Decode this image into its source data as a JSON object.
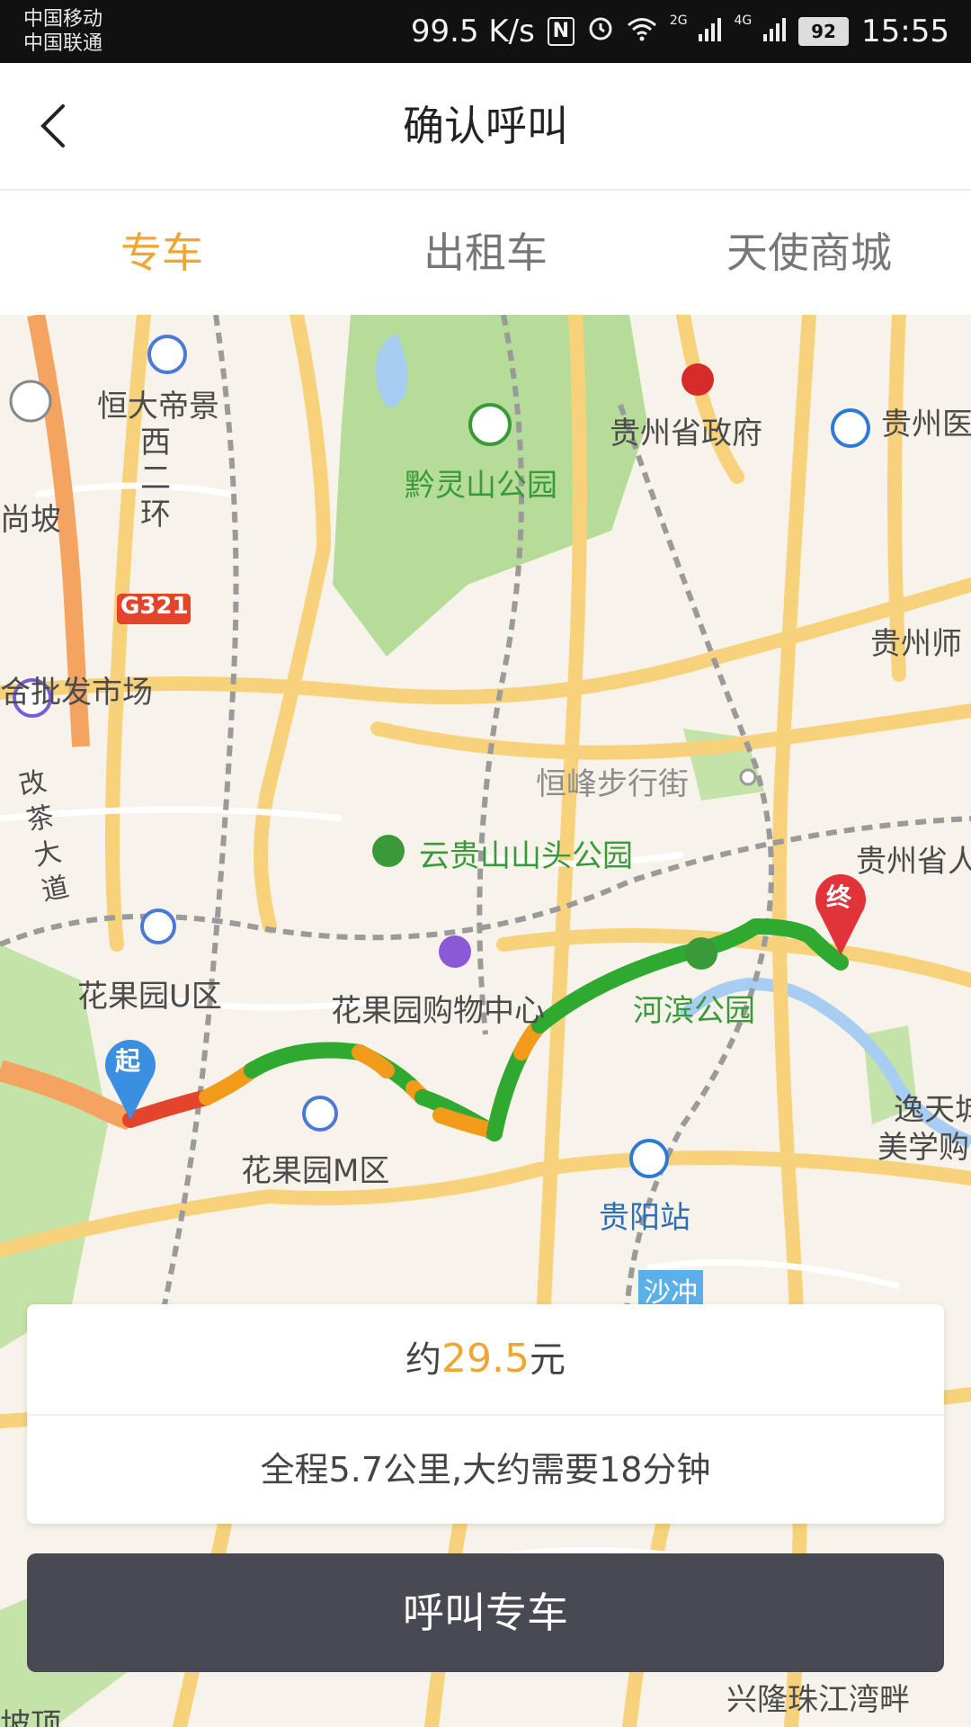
{
  "status_bar": {
    "carrier_1": "中国移动",
    "carrier_2": "中国联通",
    "net_speed": "99.5 K/s",
    "nfc": "N",
    "signal_1_label": "2G",
    "signal_2_label": "4G",
    "battery": "92",
    "time": "15:55"
  },
  "header": {
    "title": "确认呼叫"
  },
  "tabs": [
    {
      "label": "专车",
      "active": true
    },
    {
      "label": "出租车",
      "active": false
    },
    {
      "label": "天使商城",
      "active": false
    }
  ],
  "map": {
    "labels": {
      "hengda": "恒大帝景",
      "west_ring": "西二环",
      "qianling_park": "黔灵山公园",
      "provincial_gov": "贵州省政府",
      "guizhou_uni": "贵州医",
      "shangpo": "尚坡",
      "wholesale": "合批发市场",
      "normal_univ": "贵州师",
      "g321": "G321",
      "zhengfeng": "恒峰步行街",
      "zhengcha": "改茶大道",
      "yungui_park": "云贵山山头公园",
      "provincial_people": "贵州省人",
      "huaguoyuan_u": "花果园U区",
      "huaguoyuan_mall": "花果园购物中心",
      "hebin_park": "河滨公园",
      "yitian": "逸天城",
      "meixue": "美学购",
      "huaguoyuan_m": "花果园M区",
      "guiyang_station": "贵阳站",
      "shachong": "沙冲",
      "xinglong": "兴隆珠江湾畔",
      "poding": "坡顶"
    },
    "start_marker": "起",
    "end_marker": "终",
    "colors": {
      "route_green": "#2fa92f",
      "route_orange": "#f29b1b",
      "route_red": "#e2452c",
      "road_yellow": "#f8d27a",
      "park": "#b6dc9a",
      "water": "#a7cdf2"
    }
  },
  "fare": {
    "prefix": "约",
    "amount": "29.5",
    "suffix": "元"
  },
  "trip_summary": "全程5.7公里,大约需要18分钟",
  "call_button": "呼叫专车"
}
